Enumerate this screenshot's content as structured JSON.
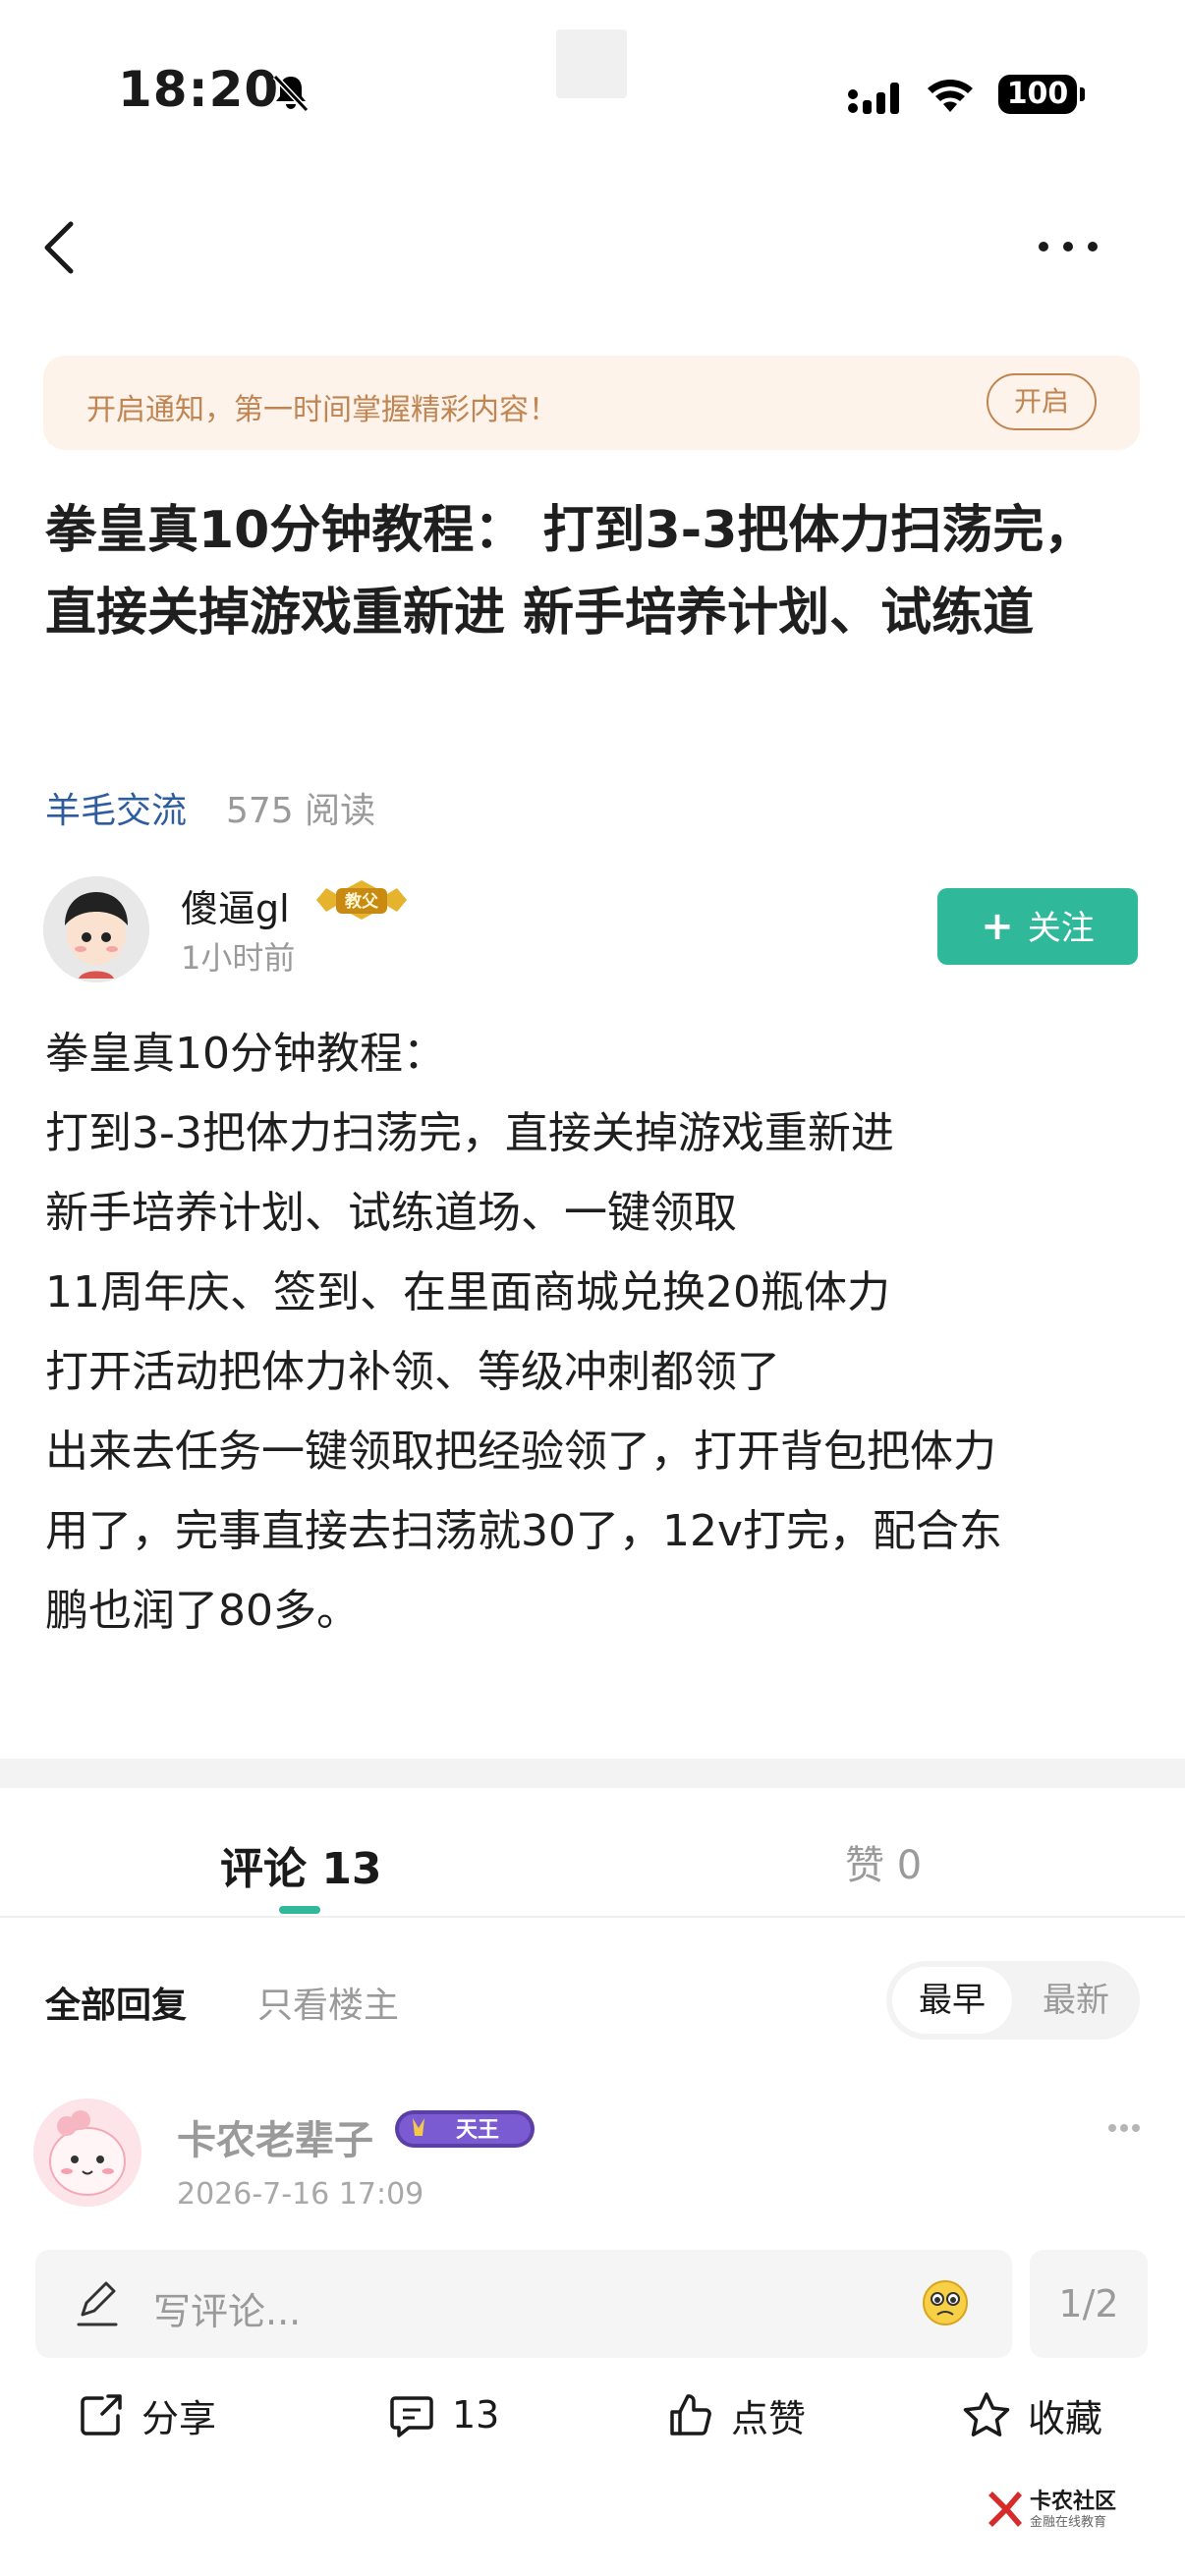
{
  "status_bar": {
    "time": "18:20",
    "battery": "100"
  },
  "notice": {
    "text": "开启通知，第一时间掌握精彩内容！",
    "button": "开启"
  },
  "post": {
    "title": "拳皇真10分钟教程： 打到3-3把体力扫荡完，直接关掉游戏重新进 新手培养计划、试练道",
    "category": "羊毛交流",
    "reads": "575 阅读",
    "author": {
      "name": "傻逼gl",
      "badge": "教父",
      "time": "1小时前"
    },
    "follow_label": "关注",
    "body_lines": [
      "拳皇真10分钟教程：",
      "打到3-3把体力扫荡完，直接关掉游戏重新进",
      "新手培养计划、试练道场、一键领取",
      "11周年庆、签到、在里面商城兑换20瓶体力",
      "打开活动把体力补领、等级冲刺都领了",
      "出来去任务一键领取把经验领了，打开背包把体力",
      "用了，完事直接去扫荡就30了，12v打完，配合东",
      "鹏也润了80多。"
    ]
  },
  "tabs": {
    "comments": "评论 13",
    "likes": "赞 0"
  },
  "filters": {
    "all": "全部回复",
    "op_only": "只看楼主",
    "sort_earliest": "最早",
    "sort_newest": "最新"
  },
  "comment": {
    "name": "卡农老辈子",
    "badge": "天王",
    "date": "2026-7-16 17:09"
  },
  "input": {
    "placeholder": "写评论...",
    "page": "1/2"
  },
  "actions": {
    "share": "分享",
    "comments": "13",
    "like": "点赞",
    "collect": "收藏"
  },
  "logo": {
    "name": "卡农社区",
    "sub": "金融在线教育"
  },
  "colors": {
    "accent": "#2fb89a",
    "notice_bg": "#fdf3ea",
    "notice_text": "#c08553",
    "category": "#2e5d9f"
  }
}
